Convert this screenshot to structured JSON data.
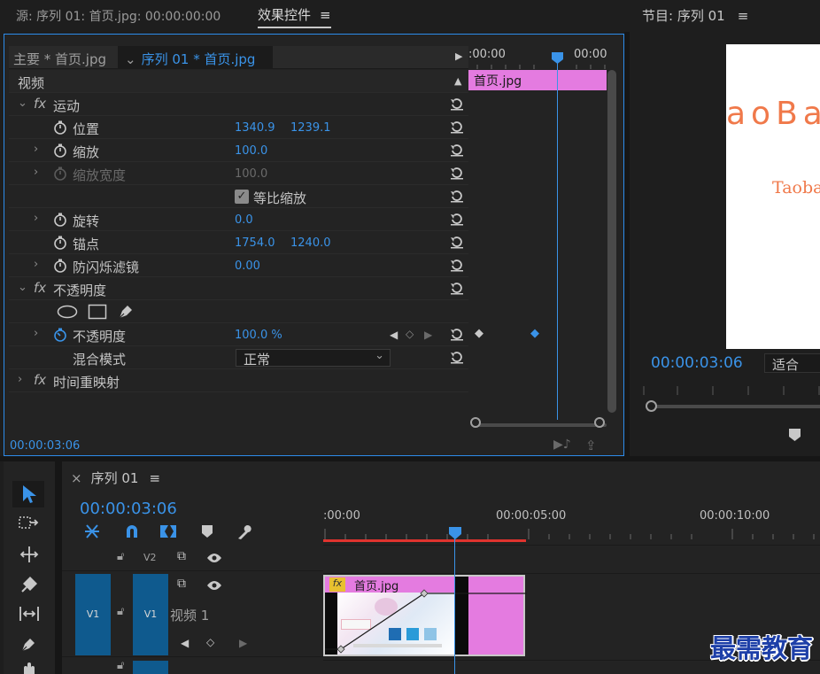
{
  "tabs": {
    "source": "源: 序列 01: 首页.jpg: 00:00:00:00",
    "effect_controls": "效果控件",
    "menu_glyph": "≡",
    "program": "节目: 序列 01"
  },
  "effect_controls": {
    "master_clip": "主要 * 首页.jpg",
    "sequence_clip": "序列 01 * 首页.jpg",
    "section_video": "视频",
    "ruler_start": ":00:00",
    "ruler_end": "00:00",
    "clip_name": "首页.jpg",
    "motion": {
      "label": "运动",
      "position_label": "位置",
      "position_x": "1340.9",
      "position_y": "1239.1",
      "scale_label": "缩放",
      "scale_value": "100.0",
      "scale_width_label": "缩放宽度",
      "scale_width_value": "100.0",
      "uniform_scale_label": "等比缩放",
      "rotation_label": "旋转",
      "rotation_value": "0.0",
      "anchor_label": "锚点",
      "anchor_x": "1754.0",
      "anchor_y": "1240.0",
      "flicker_label": "防闪烁滤镜",
      "flicker_value": "0.00"
    },
    "opacity": {
      "label": "不透明度",
      "opacity_label": "不透明度",
      "opacity_value": "100.0 %",
      "blend_label": "混合模式",
      "blend_value": "正常"
    },
    "time_remap_label": "时间重映射",
    "timecode": "00:00:03:06"
  },
  "program": {
    "logo_big": "aoBa",
    "logo_small": "Taoba",
    "timecode": "00:00:03:06",
    "fit": "适合"
  },
  "timeline": {
    "tab": "序列 01",
    "close": "×",
    "timecode": "00:00:03:06",
    "ruler": [
      ":00:00",
      "00:00:05:00",
      "00:00:10:00"
    ],
    "tracks": {
      "v2": "V2",
      "v1": "V1",
      "video1_name": "视频 1"
    },
    "clip_name": "首页.jpg"
  },
  "watermark": "最需教育",
  "colors": {
    "accent_blue": "#3a93e8",
    "clip_pink": "#e47be0",
    "panel_border": "#2d8ceb",
    "track_blue": "#0f5a8e",
    "logo_orange": "#f0794a"
  }
}
